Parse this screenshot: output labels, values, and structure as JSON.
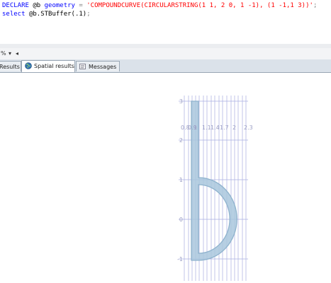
{
  "editor": {
    "line1": {
      "kw_declare": "DECLARE",
      "var": "@b",
      "kw_type": "geometry",
      "op": "=",
      "literal": "'COMPOUNDCURVE(CIRCULARSTRING(1 1, 2 0, 1 -1), (1 -1,1 3))'",
      "end": ";"
    },
    "line2": {
      "kw_select": "select",
      "expr": "@b.STBuffer(.1)",
      "end": ";"
    }
  },
  "toolbar": {
    "percent": "%",
    "dropdown": "▾",
    "arrow": "◂"
  },
  "tabs": [
    {
      "label": "Results"
    },
    {
      "label": "Spatial results"
    },
    {
      "label": "Messages"
    }
  ],
  "spatial": {
    "y_ticks": [
      "3",
      "2",
      "1",
      "0",
      "-1"
    ],
    "x_ticks": [
      "0.8",
      "0.9",
      "1",
      "1.1",
      "1.4",
      "1.7",
      "2",
      "2.3"
    ],
    "colors": {
      "grid": "#a9aee0",
      "shape_fill": "#a9c7dd",
      "shape_stroke": "#8fb3cd",
      "axis_text": "#9da0c6"
    }
  }
}
